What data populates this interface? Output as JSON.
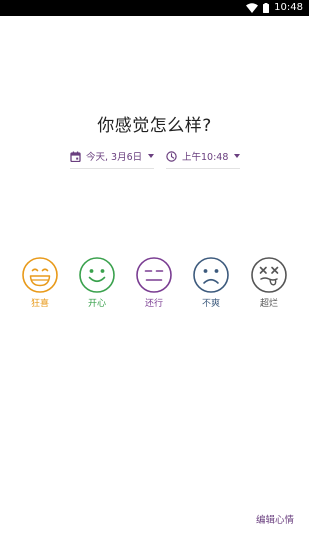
{
  "status_bar": {
    "time": "10:48",
    "icons": [
      "wifi-icon",
      "battery-icon"
    ]
  },
  "title": "你感觉怎么样?",
  "date_picker": {
    "icon": "calendar-icon",
    "value": "今天, 3月6日"
  },
  "time_picker": {
    "icon": "clock-icon",
    "value": "上午10:48"
  },
  "moods": [
    {
      "label": "狂喜",
      "color": "#e89a1a",
      "icon": "grin-face-icon"
    },
    {
      "label": "开心",
      "color": "#3aa14d",
      "icon": "smile-face-icon"
    },
    {
      "label": "还行",
      "color": "#7a3d92",
      "icon": "neutral-face-icon"
    },
    {
      "label": "不爽",
      "color": "#3c5a7d",
      "icon": "frown-face-icon"
    },
    {
      "label": "超烂",
      "color": "#555555",
      "icon": "dizzy-face-icon"
    }
  ],
  "edit_link": "编辑心情",
  "colors": {
    "accent": "#6a3f7f"
  }
}
